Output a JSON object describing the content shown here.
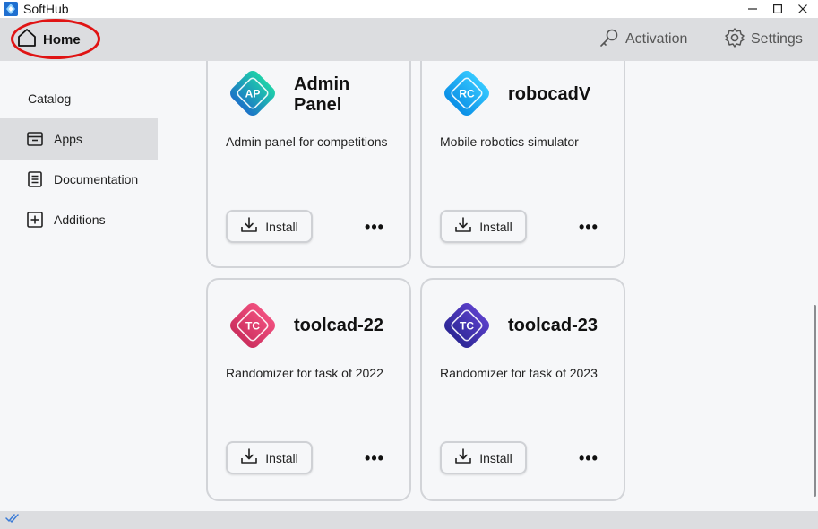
{
  "window": {
    "title": "SoftHub"
  },
  "window_controls": {
    "minimize": "—",
    "maximize": "☐",
    "close": "✕"
  },
  "nav": {
    "home": "Home",
    "activation": "Activation",
    "settings": "Settings"
  },
  "sidebar": {
    "section": "Catalog",
    "items": [
      {
        "label": "Apps",
        "icon": "apps-icon",
        "active": true
      },
      {
        "label": "Documentation",
        "icon": "document-icon",
        "active": false
      },
      {
        "label": "Additions",
        "icon": "plus-box-icon",
        "active": false
      }
    ]
  },
  "apps": [
    {
      "abbr": "AP",
      "name_line1": "Admin",
      "name_line2": "Panel",
      "description": "Admin panel for competitions",
      "install_label": "Install",
      "more": "•••",
      "color_top": "#1fd1a9",
      "color_bottom": "#1c72c8"
    },
    {
      "abbr": "RC",
      "name": "robocadV",
      "description": "Mobile robotics simulator",
      "install_label": "Install",
      "more": "•••",
      "color_top": "#35c8ff",
      "color_bottom": "#0a8fe6"
    },
    {
      "abbr": "TC",
      "name": "toolcad-22",
      "description": "Randomizer for task of 2022",
      "install_label": "Install",
      "more": "•••",
      "color_top": "#f0507f",
      "color_bottom": "#cc2f5e"
    },
    {
      "abbr": "TC",
      "name": "toolcad-23",
      "description": "Randomizer for task of 2023",
      "install_label": "Install",
      "more": "•••",
      "color_top": "#5a3fc9",
      "color_bottom": "#2d2796"
    }
  ],
  "colors": {
    "nav_bg": "#dcdde0",
    "page_bg": "#f6f7f9",
    "highlight_ring": "#e01414",
    "status_check": "#3b7bd6"
  }
}
